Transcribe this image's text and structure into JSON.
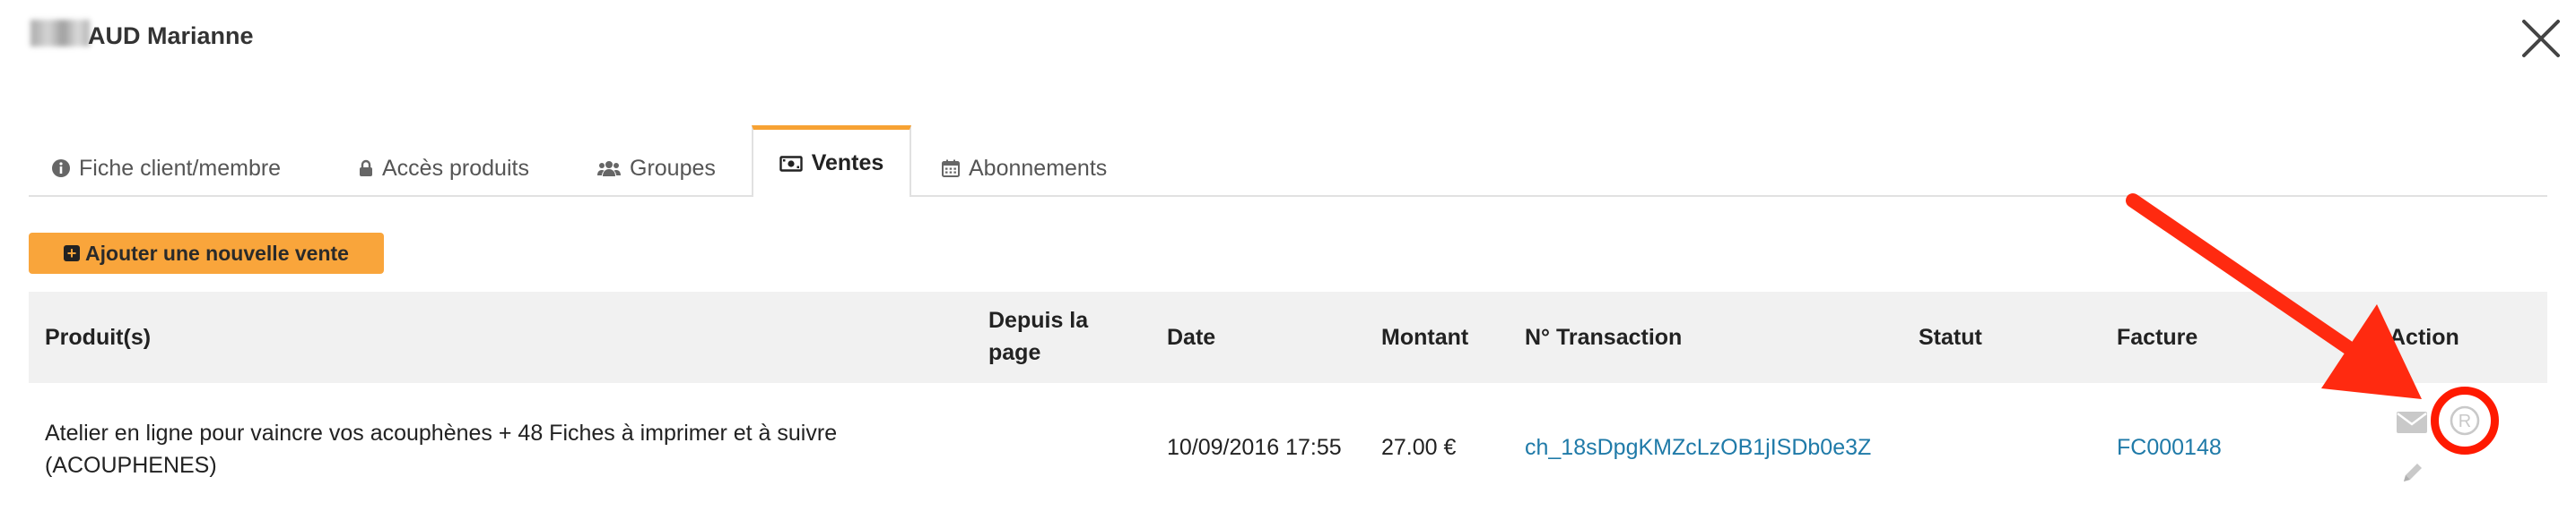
{
  "header": {
    "customer_name": "AUD Marianne"
  },
  "tabs": [
    {
      "label": "Fiche client/membre",
      "icon": "info-circle-icon",
      "active": false
    },
    {
      "label": "Accès produits",
      "icon": "lock-icon",
      "active": false
    },
    {
      "label": "Groupes",
      "icon": "users-icon",
      "active": false
    },
    {
      "label": "Ventes",
      "icon": "money-bill-icon",
      "active": true
    },
    {
      "label": "Abonnements",
      "icon": "calendar-icon",
      "active": false
    }
  ],
  "toolbar": {
    "add_sale_label": "Ajouter une nouvelle vente"
  },
  "table": {
    "columns": [
      "Produit(s)",
      "Depuis la page",
      "Date",
      "Montant",
      "N° Transaction",
      "Statut",
      "Facture",
      "Action"
    ],
    "rows": [
      {
        "product_line1": "Atelier en ligne pour vaincre vos acouphènes + 48 Fiches à imprimer et à suivre",
        "product_line2": "(ACOUPHENES)",
        "from_page": "",
        "date": "10/09/2016 17:55",
        "amount": "27.00 €",
        "transaction": "ch_18sDpgKMZcLzOB1jISDb0e3Z",
        "status": "",
        "invoice": "FC000148"
      }
    ]
  },
  "colors": {
    "accent_orange": "#f9a53b",
    "tab_active_border": "#f7a233",
    "link_blue": "#1f7aa8",
    "annotation_red": "#ff1a00",
    "header_bg": "#f1f1f1"
  }
}
